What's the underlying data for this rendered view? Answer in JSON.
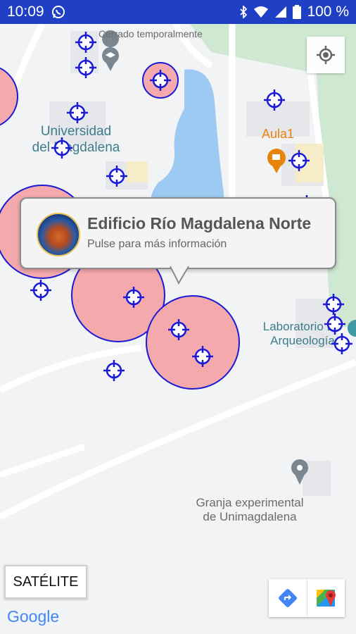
{
  "status_bar": {
    "time": "10:09",
    "battery_percent": "100 %",
    "icons": [
      "whatsapp-icon",
      "bluetooth-icon",
      "wifi-icon",
      "signal-icon",
      "battery-icon"
    ]
  },
  "map": {
    "labels": {
      "cerrado": "Cerrado temporalmente",
      "universidad_line1": "Universidad",
      "universidad_line2": "del Magdalena",
      "aula": "Aula1",
      "laboratorio_line1": "Laboratorio De",
      "laboratorio_line2": "Arqueología",
      "granja_line1": "Granja experimental",
      "granja_line2": "de Unimagdalena"
    },
    "colors": {
      "marker_blue": "#1a1ad6",
      "zone_fill": "#f4a9ad",
      "water": "#9ccaf2",
      "park": "#cfe8d1",
      "teal_label": "#3d7c8a",
      "orange_label": "#e8830c"
    }
  },
  "info_window": {
    "title": "Edificio Río Magdalena Norte",
    "subtitle": "Pulse para más información",
    "logo": "universidad-del-magdalena-logo"
  },
  "controls": {
    "satellite_label": "SATÉLITE",
    "google_logo": "Google",
    "locate_icon": "my-location-icon",
    "directions_icon": "directions-icon",
    "open_maps_icon": "google-maps-icon"
  }
}
